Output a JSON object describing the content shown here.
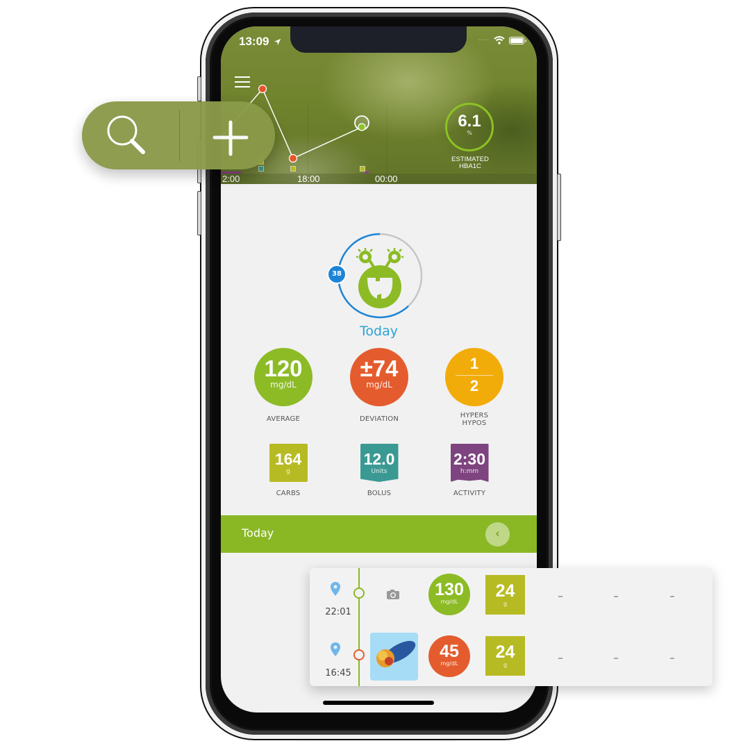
{
  "status_bar": {
    "time": "13:09",
    "location_icon": "location-arrow-icon",
    "signal": "····",
    "wifi_icon": "wifi-icon",
    "battery_icon": "battery-icon"
  },
  "header": {
    "menu_icon": "hamburger-menu-icon",
    "chart": {
      "x_tick_labels": [
        "2:00",
        "18:00",
        "00:00"
      ],
      "glucose_points": [
        {
          "time": "16:45",
          "status": "high",
          "color": "#e8542a"
        },
        {
          "time": "18:30",
          "status": "low",
          "color": "#e8542a"
        },
        {
          "time": "22:01",
          "status": "in-range",
          "color": "#8cc225",
          "selected": true
        }
      ],
      "event_markers": [
        {
          "type": "carbs",
          "color": "#b7bb23"
        },
        {
          "type": "bolus",
          "color": "#3a9a93"
        },
        {
          "type": "carbs",
          "color": "#b7bb23"
        },
        {
          "type": "carbs",
          "color": "#b7bb23"
        },
        {
          "type": "activity",
          "color": "#8a3f8a"
        }
      ]
    },
    "hba1c": {
      "value": "6.1",
      "unit": "%",
      "label_line1": "ESTIMATED",
      "label_line2": "HBA1C",
      "ring_color": "#8cc225"
    }
  },
  "floating_actions": {
    "search_icon": "search-icon",
    "add_icon": "plus-icon"
  },
  "monster": {
    "badge_value": "38",
    "progress_fraction": 0.62,
    "ring_color": "#1c84d6",
    "title": "Today"
  },
  "stats": {
    "average": {
      "value": "120",
      "unit": "mg/dL",
      "label": "AVERAGE",
      "color": "#8cbb26"
    },
    "deviation": {
      "value": "±74",
      "unit": "mg/dL",
      "label": "DEVIATION",
      "color": "#e45c2d"
    },
    "hypers_hypos": {
      "hypers": "1",
      "hypos": "2",
      "label_line1": "HYPERS",
      "label_line2": "HYPOS",
      "color": "#f2ac0a"
    },
    "carbs": {
      "value": "164",
      "unit": "g",
      "label": "CARBS",
      "color": "#b7bb23"
    },
    "bolus": {
      "value": "12.0",
      "unit": "Units",
      "label": "BOLUS",
      "color": "#3a9a93"
    },
    "activity": {
      "value": "2:30",
      "unit": "h:mm",
      "label": "ACTIVITY",
      "color": "#7d447f"
    }
  },
  "section_bar": {
    "label": "Today",
    "back_icon": "chevron-left-icon",
    "color": "#8ab825"
  },
  "log_entries": [
    {
      "time": "22:01",
      "location_icon": "location-pin-icon",
      "photo": "camera-icon",
      "glucose": "130",
      "glucose_unit": "mg/dL",
      "glucose_color": "#8cbb26",
      "node_color": "#8ab825",
      "carbs": "24",
      "carbs_unit": "g",
      "extra": [
        "-",
        "-",
        "-"
      ]
    },
    {
      "time": "16:45",
      "location_icon": "location-pin-icon",
      "photo": "food-photo",
      "glucose": "45",
      "glucose_unit": "mg/dL",
      "glucose_color": "#e45c2d",
      "node_color": "#e45c2d",
      "carbs": "24",
      "carbs_unit": "g",
      "extra": [
        "-",
        "-",
        "-"
      ]
    }
  ]
}
